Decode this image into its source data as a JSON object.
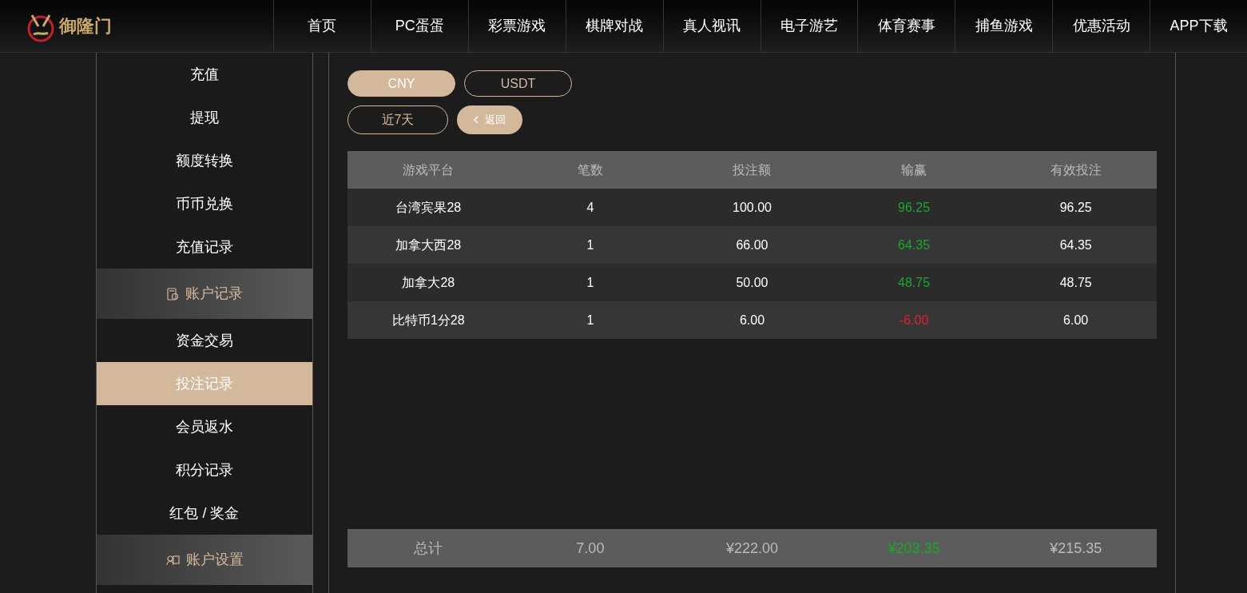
{
  "logo": {
    "text": "御隆门"
  },
  "nav": [
    {
      "label": "首页"
    },
    {
      "label": "PC蛋蛋"
    },
    {
      "label": "彩票游戏"
    },
    {
      "label": "棋牌对战"
    },
    {
      "label": "真人视讯"
    },
    {
      "label": "电子游艺"
    },
    {
      "label": "体育赛事"
    },
    {
      "label": "捕鱼游戏"
    },
    {
      "label": "优惠活动"
    },
    {
      "label": "APP下载"
    }
  ],
  "sidebar": [
    {
      "kind": "item",
      "label": "充值",
      "selected": false
    },
    {
      "kind": "item",
      "label": "提现",
      "selected": false
    },
    {
      "kind": "item",
      "label": "额度转换",
      "selected": false
    },
    {
      "kind": "item",
      "label": "币币兑换",
      "selected": false
    },
    {
      "kind": "item",
      "label": "充值记录",
      "selected": false
    },
    {
      "kind": "section",
      "label": "账户记录"
    },
    {
      "kind": "item",
      "label": "资金交易",
      "selected": false
    },
    {
      "kind": "item",
      "label": "投注记录",
      "selected": true
    },
    {
      "kind": "item",
      "label": "会员返水",
      "selected": false
    },
    {
      "kind": "item",
      "label": "积分记录",
      "selected": false
    },
    {
      "kind": "item",
      "label": "红包 / 奖金",
      "selected": false
    },
    {
      "kind": "section",
      "label": "账户设置"
    }
  ],
  "currency_tabs": [
    {
      "label": "CNY",
      "selected": true
    },
    {
      "label": "USDT",
      "selected": false
    }
  ],
  "period_button": {
    "label": "近7天"
  },
  "back_button": {
    "label": "返回"
  },
  "table": {
    "columns": [
      "游戏平台",
      "笔数",
      "投注额",
      "输赢",
      "有效投注"
    ],
    "rows": [
      {
        "platform": "台湾宾果28",
        "count": "4",
        "bet": "100.00",
        "result": "96.25",
        "color": "#18a82c",
        "valid": "96.25"
      },
      {
        "platform": "加拿大西28",
        "count": "1",
        "bet": "66.00",
        "result": "64.35",
        "color": "#18a82c",
        "valid": "64.35"
      },
      {
        "platform": "加拿大28",
        "count": "1",
        "bet": "50.00",
        "result": "48.75",
        "color": "#18a82c",
        "valid": "48.75"
      },
      {
        "platform": "比特币1分28",
        "count": "1",
        "bet": "6.00",
        "result": "-6.00",
        "color": "#e0202a",
        "valid": "6.00"
      }
    ],
    "total": {
      "label": "总计",
      "count": "7.00",
      "bet": "¥222.00",
      "result": "¥203.35",
      "color": "#18a82c",
      "valid": "¥215.35"
    }
  }
}
